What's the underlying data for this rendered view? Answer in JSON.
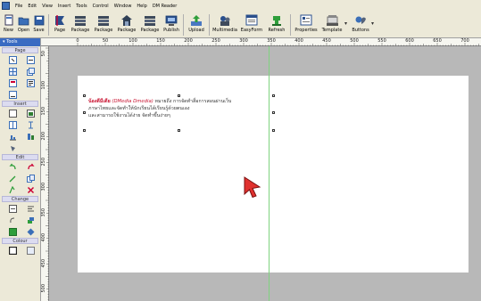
{
  "menubar": {
    "items": [
      "File",
      "Edit",
      "View",
      "Insert",
      "Tools",
      "Control",
      "Window",
      "Help",
      "DM Reader"
    ]
  },
  "toolbar": {
    "buttons": [
      {
        "label": "New",
        "icon": "new-document-icon"
      },
      {
        "label": "Open",
        "icon": "open-folder-icon"
      },
      {
        "label": "Save",
        "icon": "save-disk-icon"
      },
      {
        "label": "Page",
        "icon": "page-icon"
      },
      {
        "label": "Package",
        "icon": "package-icon"
      },
      {
        "label": "Package",
        "icon": "package-icon"
      },
      {
        "label": "Package",
        "icon": "package-icon"
      },
      {
        "label": "Package",
        "icon": "package-icon"
      },
      {
        "label": "Publish",
        "icon": "publish-icon"
      },
      {
        "label": "Upload",
        "icon": "upload-icon"
      },
      {
        "label": "Multimedia",
        "icon": "multimedia-icon"
      },
      {
        "label": "EasyForm",
        "icon": "easyform-icon"
      },
      {
        "label": "Refresh",
        "icon": "refresh-icon"
      },
      {
        "label": "Properties",
        "icon": "properties-icon"
      },
      {
        "label": "Template",
        "icon": "template-icon"
      },
      {
        "label": "Buttons",
        "icon": "buttons-icon"
      }
    ]
  },
  "toolbox": {
    "header": "Tools",
    "groups": [
      {
        "title": "Page"
      },
      {
        "title": "Insert"
      },
      {
        "title": "Edit"
      },
      {
        "title": "Change"
      },
      {
        "title": "Colour"
      }
    ]
  },
  "ruler": {
    "top": [
      "0",
      "50",
      "100",
      "150",
      "200",
      "250",
      "300",
      "350",
      "400",
      "450",
      "500",
      "550",
      "600",
      "650",
      "700"
    ],
    "left": [
      "50",
      "100",
      "150",
      "200",
      "250",
      "300",
      "350",
      "400",
      "450",
      "500"
    ]
  },
  "document": {
    "title": "น้องดีมีเดีย",
    "subtitle": "(DMedia Dmedia)",
    "line1_rest": " หมายถึง การจัดทำสื่อการสอนผ่านเว็บ",
    "line2": "ภาษาไทยและจัดทำให้นักเรียนได้เรียนรู้ด้วยตนเอง",
    "line3": "และสามารถใช้งานได้ง่าย จัดทำขึ้นง่ายๆ"
  },
  "colors": {
    "guide": "#7fd37f",
    "cursor": "#e0312e",
    "title": "#c8102e"
  }
}
